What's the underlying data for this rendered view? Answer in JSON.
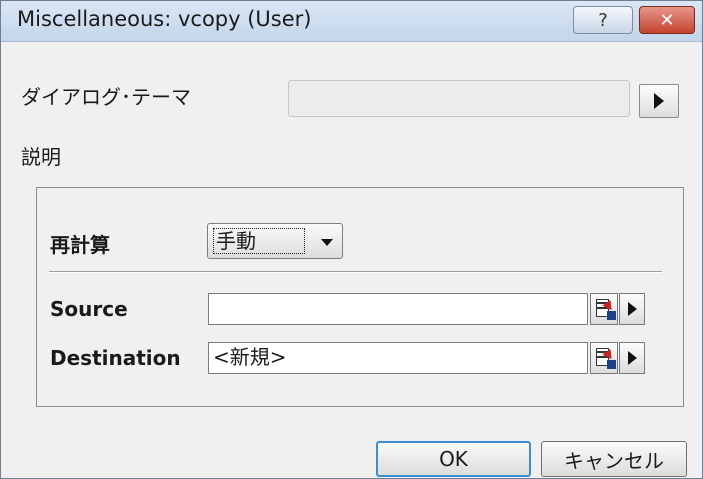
{
  "window": {
    "title": "Miscellaneous: vcopy (User)",
    "help_glyph": "?",
    "close_glyph": "✕"
  },
  "theme": {
    "label": "ダイアログ･テーマ",
    "value": ""
  },
  "description": {
    "label": "説明"
  },
  "recalc": {
    "label": "再計算",
    "selected": "手動"
  },
  "source": {
    "label": "Source",
    "value": ""
  },
  "destination": {
    "label": "Destination",
    "value": "<新規>"
  },
  "buttons": {
    "ok": "OK",
    "cancel": "キャンセル"
  },
  "colors": {
    "titlebar": "#c4d5ea",
    "close": "#c5432d",
    "ok_border": "#3a8ed4",
    "background": "#f0f0f0"
  }
}
